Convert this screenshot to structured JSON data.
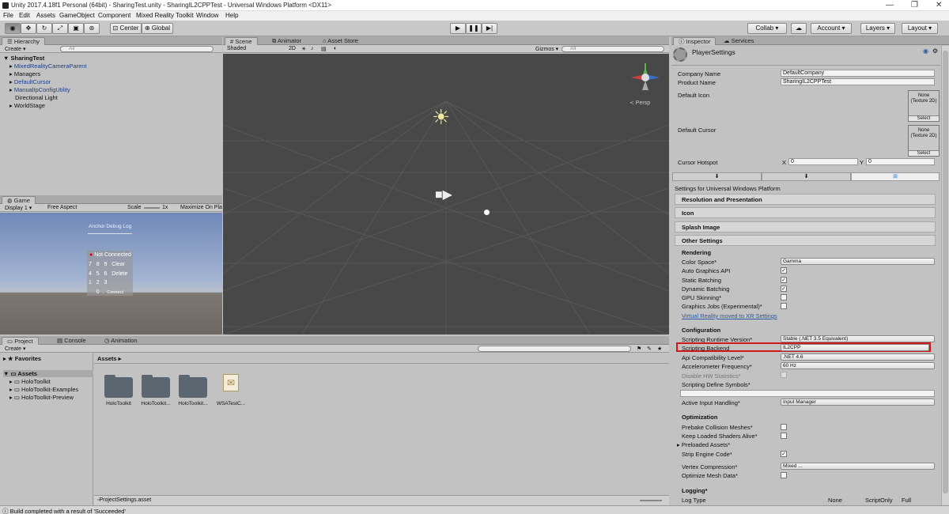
{
  "window": {
    "title": "Unity 2017.4.18f1 Personal (64bit) - SharingTest.unity - SharingIL2CPPTest - Universal Windows Platform <DX11>"
  },
  "menu": [
    "File",
    "Edit",
    "Assets",
    "GameObject",
    "Component",
    "Mixed Reality Toolkit",
    "Window",
    "Help"
  ],
  "toolbar": {
    "pivot_center": "Center",
    "pivot_global": "Global",
    "collab": "Collab ▾",
    "account": "Account",
    "layers": "Layers",
    "layout": "Layout"
  },
  "hierarchy": {
    "tab": "Hierarchy",
    "create": "Create ▾",
    "search_placeholder": "All",
    "scene_name": "SharingTest",
    "items": [
      {
        "label": "MixedRealityCameraParent",
        "blue": true,
        "arrow": true
      },
      {
        "label": "Managers",
        "blue": false,
        "arrow": true
      },
      {
        "label": "DefaultCursor",
        "blue": true,
        "arrow": true
      },
      {
        "label": "ManualIpConfigUtility",
        "blue": true,
        "arrow": true
      },
      {
        "label": "Directional Light",
        "blue": false,
        "arrow": false
      },
      {
        "label": "WorldStage",
        "blue": false,
        "arrow": true
      }
    ]
  },
  "scene": {
    "tabs": [
      "Scene",
      "Animator",
      "Asset Store"
    ],
    "shaded": "Shaded",
    "mode_2d": "2D",
    "gizmos": "Gizmos ▾",
    "search_placeholder": "All",
    "persp": "≺ Persp"
  },
  "game": {
    "tab": "Game",
    "display": "Display 1",
    "aspect": "Free Aspect",
    "scale_label": "Scale",
    "scale_value": "1x",
    "maximize": "Maximize On Pla",
    "debug_title": "Anchor Debug Log",
    "status": "Not Connected",
    "keys": [
      "7",
      "8",
      "9",
      "Clear",
      "4",
      "5",
      "6",
      "Delete",
      "1",
      "2",
      "3",
      "",
      "0",
      ".",
      "Connect"
    ]
  },
  "project": {
    "tabs": [
      "Project",
      "Console",
      "Animation"
    ],
    "create": "Create ▾",
    "favorites": "Favorites",
    "assets_root": "Assets",
    "tree_items": [
      "HoloToolkit",
      "HoloToolkit-Examples",
      "HoloToolkit-Preview"
    ],
    "breadcrumb": "Assets ▸",
    "assets": [
      {
        "label": "HoloToolkit",
        "type": "folder"
      },
      {
        "label": "HoloToolkit...",
        "type": "folder"
      },
      {
        "label": "HoloToolkit...",
        "type": "folder"
      },
      {
        "label": "WSATestC...",
        "type": "script"
      }
    ],
    "footer_file": "ProjectSettings.asset"
  },
  "inspector": {
    "tabs": [
      "Inspector",
      "Services"
    ],
    "title": "PlayerSettings",
    "company_label": "Company Name",
    "company_value": "DefaultCompany",
    "product_label": "Product Name",
    "product_value": "SharingIL2CPPTest",
    "default_icon": "Default Icon",
    "default_cursor": "Default Cursor",
    "tex_none": "None",
    "tex_type": "(Texture 2D)",
    "tex_select": "Select",
    "hotspot_label": "Cursor Hotspot",
    "hotspot_x_label": "X",
    "hotspot_x": "0",
    "hotspot_y_label": "Y",
    "hotspot_y": "0",
    "platform_header": "Settings for Universal Windows Platform",
    "sections": [
      "Resolution and Presentation",
      "Icon",
      "Splash Image"
    ],
    "other_settings": "Other Settings",
    "rendering": "Rendering",
    "color_space_label": "Color Space*",
    "color_space_value": "Gamma",
    "auto_graphics": "Auto Graphics API",
    "static_batching": "Static Batching",
    "dynamic_batching": "Dynamic Batching",
    "gpu_skinning": "GPU Skinning*",
    "graphics_jobs": "Graphics Jobs (Experimental)*",
    "vr_link": "Virtual Reality moved to XR Settings",
    "configuration": "Configuration",
    "runtime_label": "Scripting Runtime Version*",
    "runtime_value": "Stable (.NET 3.5 Equivalent)",
    "backend_label": "Scripting Backend",
    "backend_value": "IL2CPP",
    "api_label": "Api Compatibility Level*",
    "api_value": ".NET 4.6",
    "accel_label": "Accelerometer Frequency*",
    "accel_value": "60 Hz",
    "hw_stats": "Disable HW Statistics*",
    "define_symbols": "Scripting Define Symbols*",
    "input_label": "Active Input Handling*",
    "input_value": "Input Manager",
    "optimization": "Optimization",
    "prebake": "Prebake Collision Meshes*",
    "keep_shaders": "Keep Loaded Shaders Alive*",
    "preloaded": "Preloaded Assets*",
    "strip": "Strip Engine Code*",
    "vertex_label": "Vertex Compression*",
    "vertex_value": "Mixed ...",
    "optimize_mesh": "Optimize Mesh Data*",
    "logging": "Logging*",
    "log_type": "Log Type",
    "log_none": "None",
    "log_script": "ScriptOnly",
    "log_full": "Full"
  },
  "status": {
    "message": "Build completed with a result of 'Succeeded'"
  }
}
